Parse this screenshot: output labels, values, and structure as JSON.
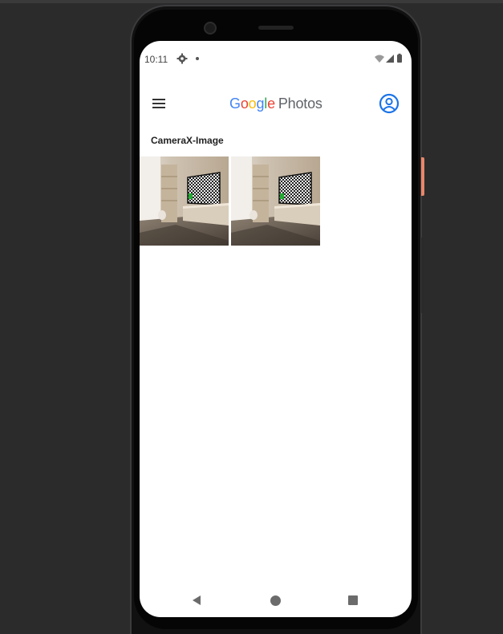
{
  "status_bar": {
    "time": "10:11",
    "left_icons": [
      "settings-icon",
      "notification-dot"
    ],
    "right_icons": [
      "wifi-icon",
      "signal-icon",
      "battery-icon"
    ]
  },
  "app_bar": {
    "menu_icon": "hamburger-menu-icon",
    "logo_google": [
      "G",
      "o",
      "o",
      "g",
      "l",
      "e"
    ],
    "logo_product": "Photos",
    "account_icon": "account-circle-icon",
    "brand_colors": {
      "blue": "#4285f4",
      "red": "#ea4335",
      "yellow": "#fbbc05",
      "green": "#34a853",
      "accent": "#1a73e8"
    }
  },
  "album": {
    "title": "CameraX-Image",
    "photos": [
      {
        "subject": "room with checkerboard TV screen"
      },
      {
        "subject": "room with checkerboard TV screen"
      }
    ]
  },
  "nav_bar": {
    "buttons": [
      "back-icon",
      "home-icon",
      "recents-icon"
    ]
  }
}
